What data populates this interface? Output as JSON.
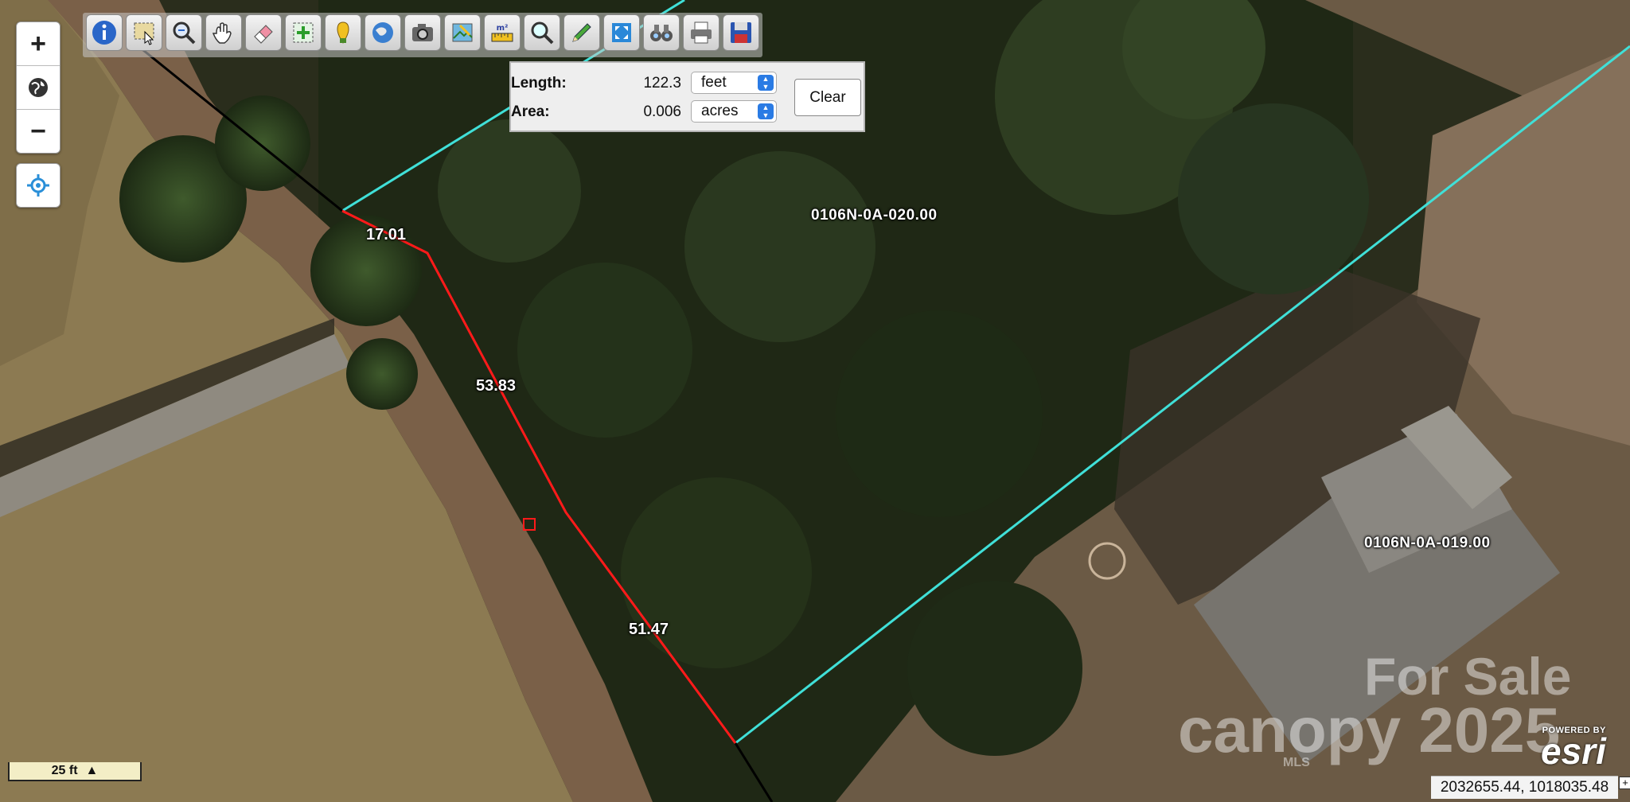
{
  "map": {
    "parcel_labels": [
      "0106N-0A-020.00",
      "0106N-0A-019.00"
    ],
    "segment_labels": [
      "17.01",
      "53.83",
      "51.47"
    ],
    "scale_label": "25 ft",
    "coordinates": "2032655.44, 1018035.48",
    "watermark_line1": "For Sale",
    "watermark_line2": "canopy 2025",
    "watermark_line3": "MLS",
    "attribution_powered": "POWERED BY",
    "attribution_brand": "esri",
    "colors": {
      "parcel_line": "#40e0d8",
      "measure_line": "#ff1a1a"
    }
  },
  "zoom_controls": {
    "zoom_in": "+",
    "home_icon": "globe-icon",
    "zoom_out": "−",
    "locate_icon": "crosshair-icon"
  },
  "toolbar": {
    "tools": [
      "info-icon",
      "select-icon",
      "zoom-box-icon",
      "pan-icon",
      "eraser-icon",
      "add-feature-icon",
      "marker-icon",
      "globe-icon",
      "camera-icon",
      "layers-edit-icon",
      "measure-icon",
      "search-icon",
      "draw-icon",
      "fit-extent-icon",
      "binoculars-icon",
      "print-icon",
      "save-icon"
    ]
  },
  "measure": {
    "length_label": "Length:",
    "length_value": "122.3",
    "length_unit": "feet",
    "area_label": "Area:",
    "area_value": "0.006",
    "area_unit": "acres",
    "clear_label": "Clear"
  }
}
